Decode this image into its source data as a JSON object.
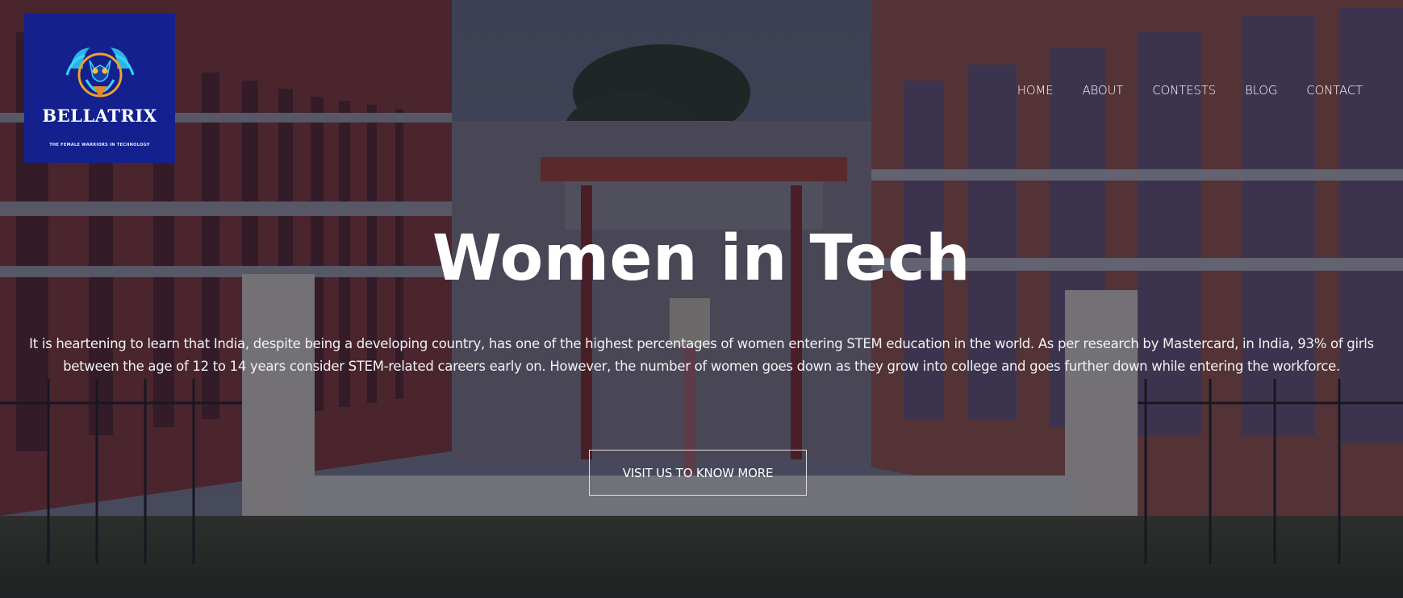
{
  "logo": {
    "title": "BELLATRIX",
    "tagline": "THE FEMALE WARRIORS IN TECHNOLOGY",
    "bg_color": "#13208e"
  },
  "nav": {
    "items": [
      {
        "label": "HOME"
      },
      {
        "label": "ABOUT"
      },
      {
        "label": "CONTESTS"
      },
      {
        "label": "BLOG"
      },
      {
        "label": "CONTACT"
      }
    ]
  },
  "hero": {
    "title": "Women in Tech",
    "body": "It is heartening to learn that India, despite being a developing country, has one of the highest percentages of women entering STEM education in the world. As per research by Mastercard, in India, 93% of girls between the age of 12 to 14 years consider STEM-related careers early on. However, the number of women goes down as they grow into college and goes further down while entering the workforce.",
    "cta_label": "VISIT US TO KNOW MORE"
  }
}
